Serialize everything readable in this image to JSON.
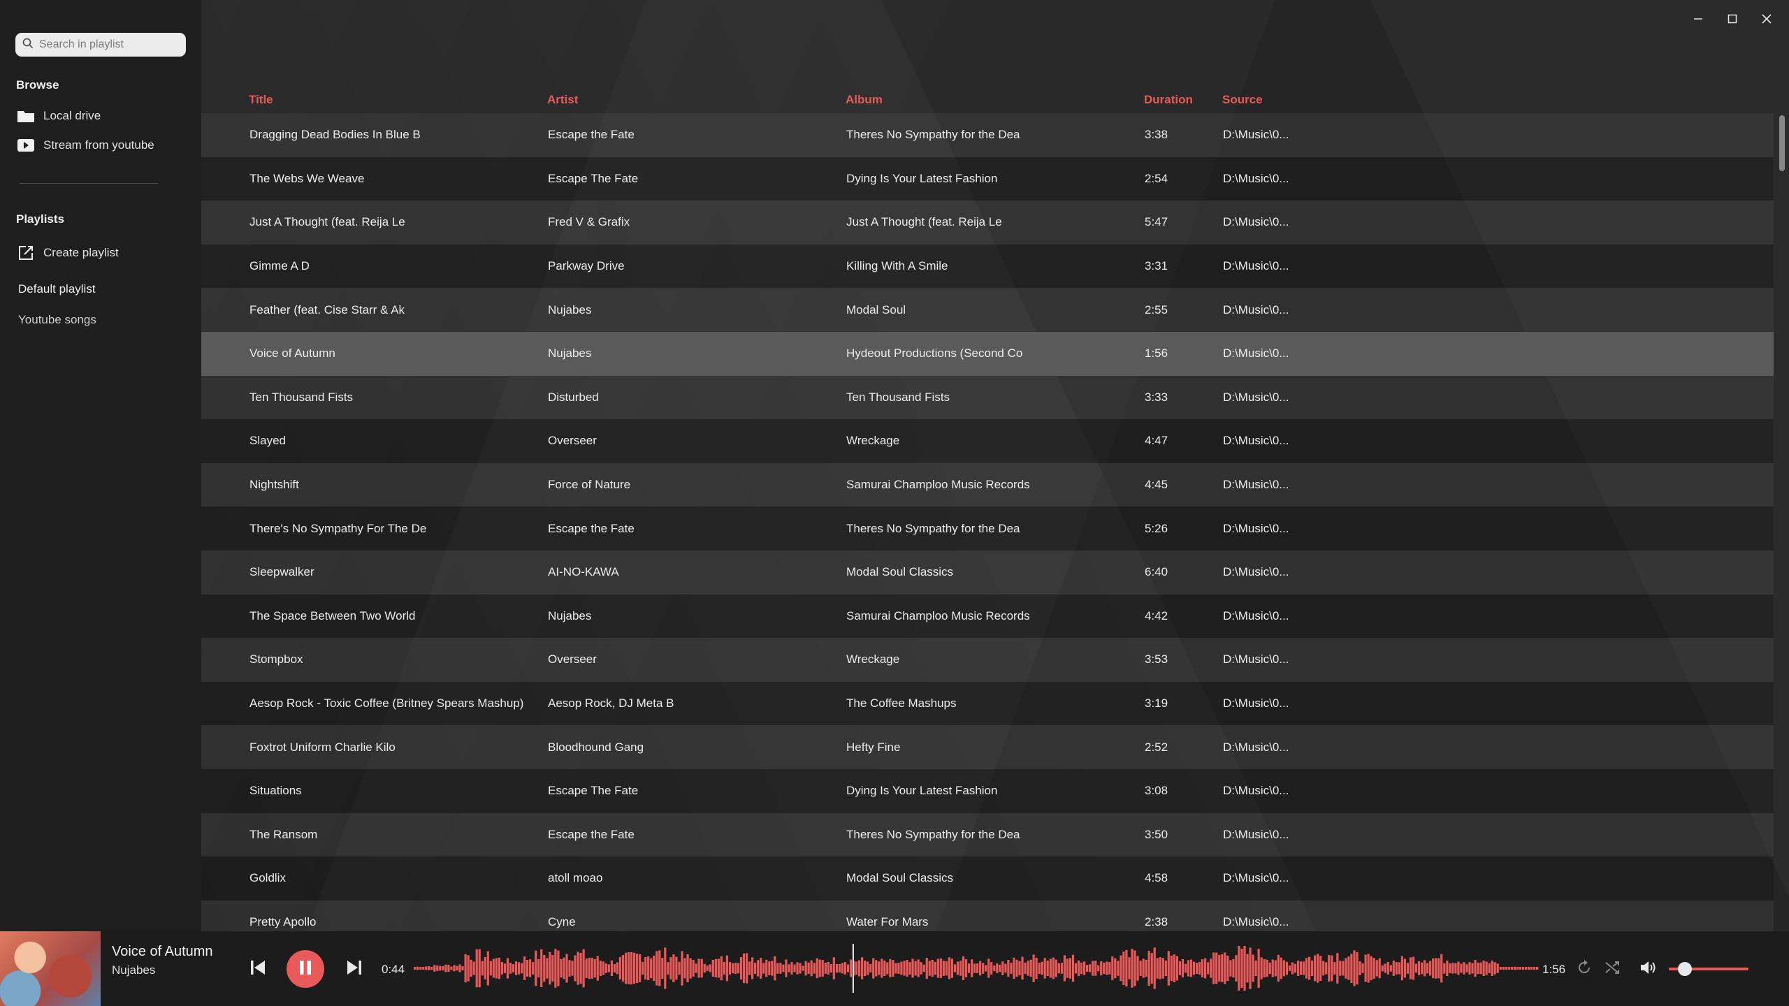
{
  "search": {
    "placeholder": "Search in playlist"
  },
  "browse": {
    "heading": "Browse",
    "items": [
      {
        "label": "Local drive",
        "icon": "folder-icon"
      },
      {
        "label": "Stream from youtube",
        "icon": "youtube-icon"
      }
    ]
  },
  "playlists": {
    "heading": "Playlists",
    "create_label": "Create playlist",
    "items": [
      "Default playlist",
      "Youtube songs"
    ]
  },
  "columns": {
    "title": "Title",
    "artist": "Artist",
    "album": "Album",
    "duration": "Duration",
    "source": "Source"
  },
  "tracks": [
    {
      "title": "Dragging Dead Bodies In Blue B",
      "artist": "Escape the Fate",
      "album": "Theres No Sympathy for the Dea",
      "duration": "3:38",
      "source": "D:\\Music\\0..."
    },
    {
      "title": "The Webs We Weave",
      "artist": "Escape The Fate",
      "album": "Dying Is Your Latest Fashion",
      "duration": "2:54",
      "source": "D:\\Music\\0..."
    },
    {
      "title": "Just A Thought (feat. Reija Le",
      "artist": "Fred V & Grafix",
      "album": "Just A Thought (feat. Reija Le",
      "duration": "5:47",
      "source": "D:\\Music\\0..."
    },
    {
      "title": "Gimme A D",
      "artist": "Parkway Drive",
      "album": "Killing With A Smile",
      "duration": "3:31",
      "source": "D:\\Music\\0..."
    },
    {
      "title": "Feather (feat. Cise Starr & Ak",
      "artist": "Nujabes",
      "album": "Modal Soul",
      "duration": "2:55",
      "source": "D:\\Music\\0..."
    },
    {
      "title": "Voice of Autumn",
      "artist": "Nujabes",
      "album": "Hydeout Productions (Second Co",
      "duration": "1:56",
      "source": "D:\\Music\\0...",
      "selected": true
    },
    {
      "title": "Ten Thousand Fists",
      "artist": "Disturbed",
      "album": "Ten Thousand Fists",
      "duration": "3:33",
      "source": "D:\\Music\\0..."
    },
    {
      "title": "Slayed",
      "artist": "Overseer",
      "album": "Wreckage",
      "duration": "4:47",
      "source": "D:\\Music\\0..."
    },
    {
      "title": "Nightshift",
      "artist": "Force of Nature",
      "album": "Samurai Champloo Music Records",
      "duration": "4:45",
      "source": "D:\\Music\\0..."
    },
    {
      "title": "There's No Sympathy For The De",
      "artist": "Escape the Fate",
      "album": "Theres No Sympathy for the Dea",
      "duration": "5:26",
      "source": "D:\\Music\\0..."
    },
    {
      "title": "Sleepwalker",
      "artist": "AI-NO-KAWA",
      "album": "Modal Soul Classics",
      "duration": "6:40",
      "source": "D:\\Music\\0..."
    },
    {
      "title": "The Space Between Two World",
      "artist": "Nujabes",
      "album": "Samurai Champloo Music Records",
      "duration": "4:42",
      "source": "D:\\Music\\0..."
    },
    {
      "title": "Stompbox",
      "artist": "Overseer",
      "album": "Wreckage",
      "duration": "3:53",
      "source": "D:\\Music\\0..."
    },
    {
      "title": "Aesop Rock - Toxic Coffee (Britney Spears Mashup)",
      "artist": "Aesop Rock, DJ Meta B",
      "album": "The Coffee Mashups",
      "duration": "3:19",
      "source": "D:\\Music\\0..."
    },
    {
      "title": "Foxtrot Uniform Charlie Kilo",
      "artist": "Bloodhound Gang",
      "album": "Hefty Fine",
      "duration": "2:52",
      "source": "D:\\Music\\0..."
    },
    {
      "title": "Situations",
      "artist": "Escape The Fate",
      "album": "Dying Is Your Latest Fashion",
      "duration": "3:08",
      "source": "D:\\Music\\0..."
    },
    {
      "title": "The Ransom",
      "artist": "Escape the Fate",
      "album": "Theres No Sympathy for the Dea",
      "duration": "3:50",
      "source": "D:\\Music\\0..."
    },
    {
      "title": "Goldlix",
      "artist": "atoll moao",
      "album": "Modal Soul Classics",
      "duration": "4:58",
      "source": "D:\\Music\\0..."
    },
    {
      "title": "Pretty Apollo",
      "artist": "Cyne",
      "album": "Water For Mars",
      "duration": "2:38",
      "source": "D:\\Music\\0..."
    }
  ],
  "player": {
    "title": "Voice of Autumn",
    "artist": "Nujabes",
    "elapsed": "0:44",
    "total": "1:56",
    "progress": 0.39,
    "volume": 0.2
  },
  "colors": {
    "accent": "#e8595a",
    "background": "#2b2b2b",
    "sidebar": "#1e1e1e",
    "selected_row": "#5a5a5a"
  }
}
